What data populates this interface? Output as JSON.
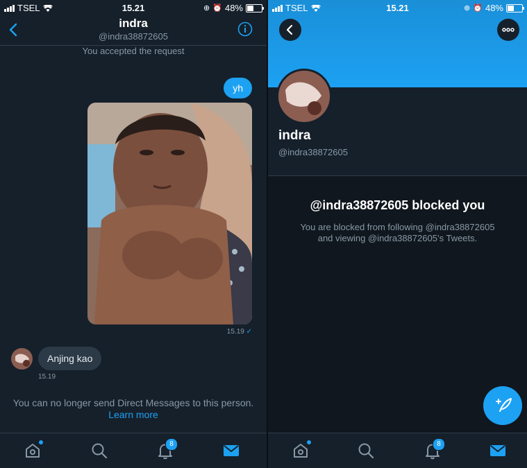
{
  "status": {
    "carrier": "TSEL",
    "time": "15.21",
    "battery": "48%"
  },
  "dm": {
    "name": "indra",
    "handle": "@indra38872605",
    "system_note": "You accepted the request",
    "sent_message": "yh",
    "sent_time": "15.19",
    "sent_check": "✓",
    "received_message": "Anjing kao",
    "received_time": "15.19",
    "notice": "You can no longer send Direct Messages to this person.",
    "learn_more": "Learn more"
  },
  "profile": {
    "name": "indra",
    "handle": "@indra38872605",
    "blocked_title": "@indra38872605 blocked you",
    "blocked_line1": "You are blocked from following @indra38872605",
    "blocked_line2": "and viewing @indra38872605’s Tweets."
  },
  "tabbar": {
    "notification_count": "8"
  },
  "colors": {
    "accent": "#1da1f2",
    "background": "#15202b",
    "muted": "#8899a6"
  },
  "icons": [
    "back-icon",
    "info-icon",
    "home-icon",
    "search-icon",
    "bell-icon",
    "mail-icon",
    "more-icon",
    "compose-icon",
    "wifi-icon",
    "battery-icon"
  ]
}
